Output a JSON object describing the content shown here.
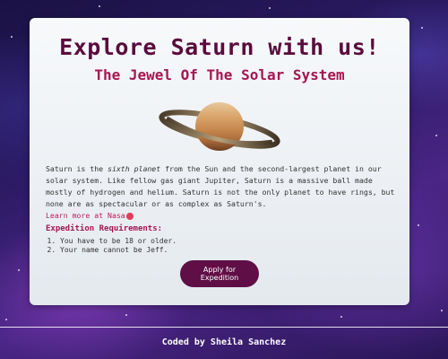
{
  "page": {
    "title": "Explore Saturn with us!",
    "subtitle": "The Jewel Of The Solar System"
  },
  "intro": {
    "part1": "Saturn is the ",
    "emphasis": "sixth planet",
    "part2": " from the Sun and the second-largest planet in our solar system. Like fellow gas giant Jupiter, Saturn is a massive ball made mostly of hydrogen and helium. Saturn is not the only planet to have rings, but none are as spectacular or as complex as Saturn's.",
    "link_text": "Learn more at Nasa"
  },
  "requirements": {
    "heading": "Expedition Requirements:",
    "items": [
      "You have to be 18 or older.",
      "Your name cannot be Jeff."
    ]
  },
  "apply_button": "Apply for Expedition",
  "footer": "Coded by Sheila Sanchez",
  "icons": {
    "planet": "saturn-image",
    "link_emoji": "heart-eyes-emoji"
  },
  "colors": {
    "title": "#5a0b3d",
    "accent": "#a51653",
    "button": "#5f0f46"
  }
}
